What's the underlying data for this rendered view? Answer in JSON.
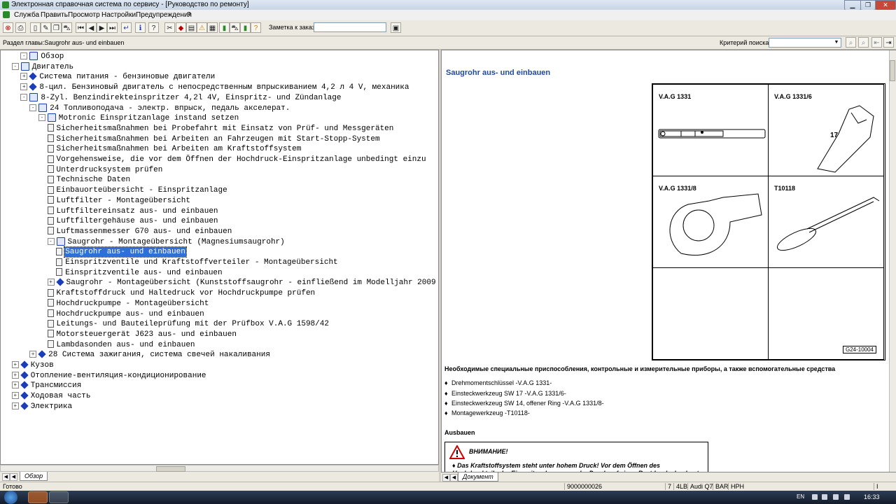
{
  "window": {
    "title": "Электронная справочная система по сервису - [Руководство по ремонту]"
  },
  "menu": [
    "Служба",
    "Править",
    "Просмотр",
    "Настройки",
    "Предупреждения",
    "?"
  ],
  "toolbar": {
    "order_label": "Заметка к заказу:",
    "order_value": ""
  },
  "infobar": {
    "section_label": "Раздел главы:Saugrohr aus- und einbauen",
    "criteria_label": "Критерий поиска:",
    "criteria_value": ""
  },
  "tree": {
    "nodes": [
      {
        "label": "Обзор",
        "exp": "-"
      },
      {
        "label": "Двигатель",
        "exp": "-"
      },
      {
        "label": "Система питания - бензиновые двигатели",
        "exp": "+"
      },
      {
        "label": "8-цил. Бензиновый двигатель с непосредственным впрыскиванием 4,2 л 4 V, механика",
        "exp": "+"
      },
      {
        "label": "8-Zyl. Benzindirekteinspritzer 4,2l 4V, Einspritz- und Zündanlage",
        "exp": "-"
      },
      {
        "label": "24 Топливоподача - электр. впрыск, педаль акселерат.",
        "exp": "-"
      },
      {
        "label": "Motronic Einspritzanlage instand setzen",
        "exp": "-"
      },
      {
        "label": "Sicherheitsmaßnahmen bei Probefahrt mit Einsatz von Prüf- und Messgeräten",
        "exp": ""
      },
      {
        "label": "Sicherheitsmaßnahmen bei Arbeiten an Fahrzeugen mit Start-Stopp-System",
        "exp": ""
      },
      {
        "label": "Sicherheitsmaßnahmen bei Arbeiten am Kraftstoffsystem",
        "exp": ""
      },
      {
        "label": "Vorgehensweise, die vor dem Öffnen der Hochdruck-Einspritzanlage unbedingt einzu",
        "exp": ""
      },
      {
        "label": "Unterdrucksystem prüfen",
        "exp": ""
      },
      {
        "label": "Technische Daten",
        "exp": ""
      },
      {
        "label": "Einbauorteübersicht - Einspritzanlage",
        "exp": ""
      },
      {
        "label": "Luftfilter - Montageübersicht",
        "exp": ""
      },
      {
        "label": "Luftfiltereinsatz aus- und einbauen",
        "exp": ""
      },
      {
        "label": "Luftfiltergehäuse aus- und einbauen",
        "exp": ""
      },
      {
        "label": "Luftmassenmesser G70 aus- und einbauen",
        "exp": ""
      },
      {
        "label": "Saugrohr - Montageübersicht (Magnesiumsaugrohr)",
        "exp": "-"
      },
      {
        "label": "Saugrohr aus- und einbauen",
        "exp": ""
      },
      {
        "label": "Einspritzventile und Kraftstoffverteiler - Montageübersicht",
        "exp": ""
      },
      {
        "label": "Einspritzventile aus- und einbauen",
        "exp": ""
      },
      {
        "label": "Saugrohr - Montageübersicht (Kunststoffsaugrohr - einfließend im Modelljahr 2009",
        "exp": "+"
      },
      {
        "label": "Kraftstoffdruck und Haltedruck vor Hochdruckpumpe prüfen",
        "exp": ""
      },
      {
        "label": "Hochdruckpumpe - Montageübersicht",
        "exp": ""
      },
      {
        "label": "Hochdruckpumpe aus- und einbauen",
        "exp": ""
      },
      {
        "label": "Leitungs- und Bauteileprüfung mit der Prüfbox V.A.G 1598/42",
        "exp": ""
      },
      {
        "label": "Motorsteuergerät J623 aus- und einbauen",
        "exp": ""
      },
      {
        "label": "Lambdasonden aus- und einbauen",
        "exp": ""
      },
      {
        "label": "28 Система зажигания, система свечей накаливания",
        "exp": "+"
      },
      {
        "label": "Кузов",
        "exp": "+"
      },
      {
        "label": "Отопление-вентиляция-кондиционирование",
        "exp": "+"
      },
      {
        "label": "Трансмиссия",
        "exp": "+"
      },
      {
        "label": "Ходовая часть",
        "exp": "+"
      },
      {
        "label": "Электрика",
        "exp": "+"
      }
    ],
    "selected_index": 19
  },
  "left_tab": "Обзор",
  "document": {
    "title": "Saugrohr aus- und einbauen",
    "tools": [
      {
        "label": "V.A.G 1331"
      },
      {
        "label": "V.A.G 1331/6"
      },
      {
        "label": "V.A.G 1331/8"
      },
      {
        "label": "T10118"
      },
      {
        "label": ""
      },
      {
        "label": ""
      }
    ],
    "wrench_size": "17",
    "figure_id": "G24-10004",
    "required_title": "Необходимые специальные приспособления, контрольные и измерительные приборы, а также вспомогательные средства",
    "required_items": [
      "Drehmomentschlüssel -V.A.G 1331-",
      "Einsteckwerkzeug SW 17 -V.A.G 1331/6-",
      "Einsteckwerkzeug SW 14, offener Ring -V.A.G 1331/8-",
      "Montagewerkzeug -T10118-"
    ],
    "section": "Ausbauen",
    "warning_title": "ВНИМАНИЕ!",
    "warning_text": "Das Kraftstoffsystem steht unter hohem Druck! Vor dem Öffnen des Hochdruckteils der Einspritzanlage muss der Druck auf einen Restdruck abgebaut"
  },
  "right_tab": "Документ",
  "status": {
    "left": "Готово",
    "order": "9000000026",
    "f1": "7",
    "f2": "4LB",
    "f3": "Audi Q7",
    "f4": "BAR",
    "f5": "HPH",
    "f6": "I"
  },
  "taskbar": {
    "lang": "EN",
    "time": "16:33"
  },
  "colors": {
    "selection": "#2f6fd6",
    "doc_title": "#1f4a9a",
    "book_icon": "#1a3db8",
    "warning": "#cc0000"
  }
}
